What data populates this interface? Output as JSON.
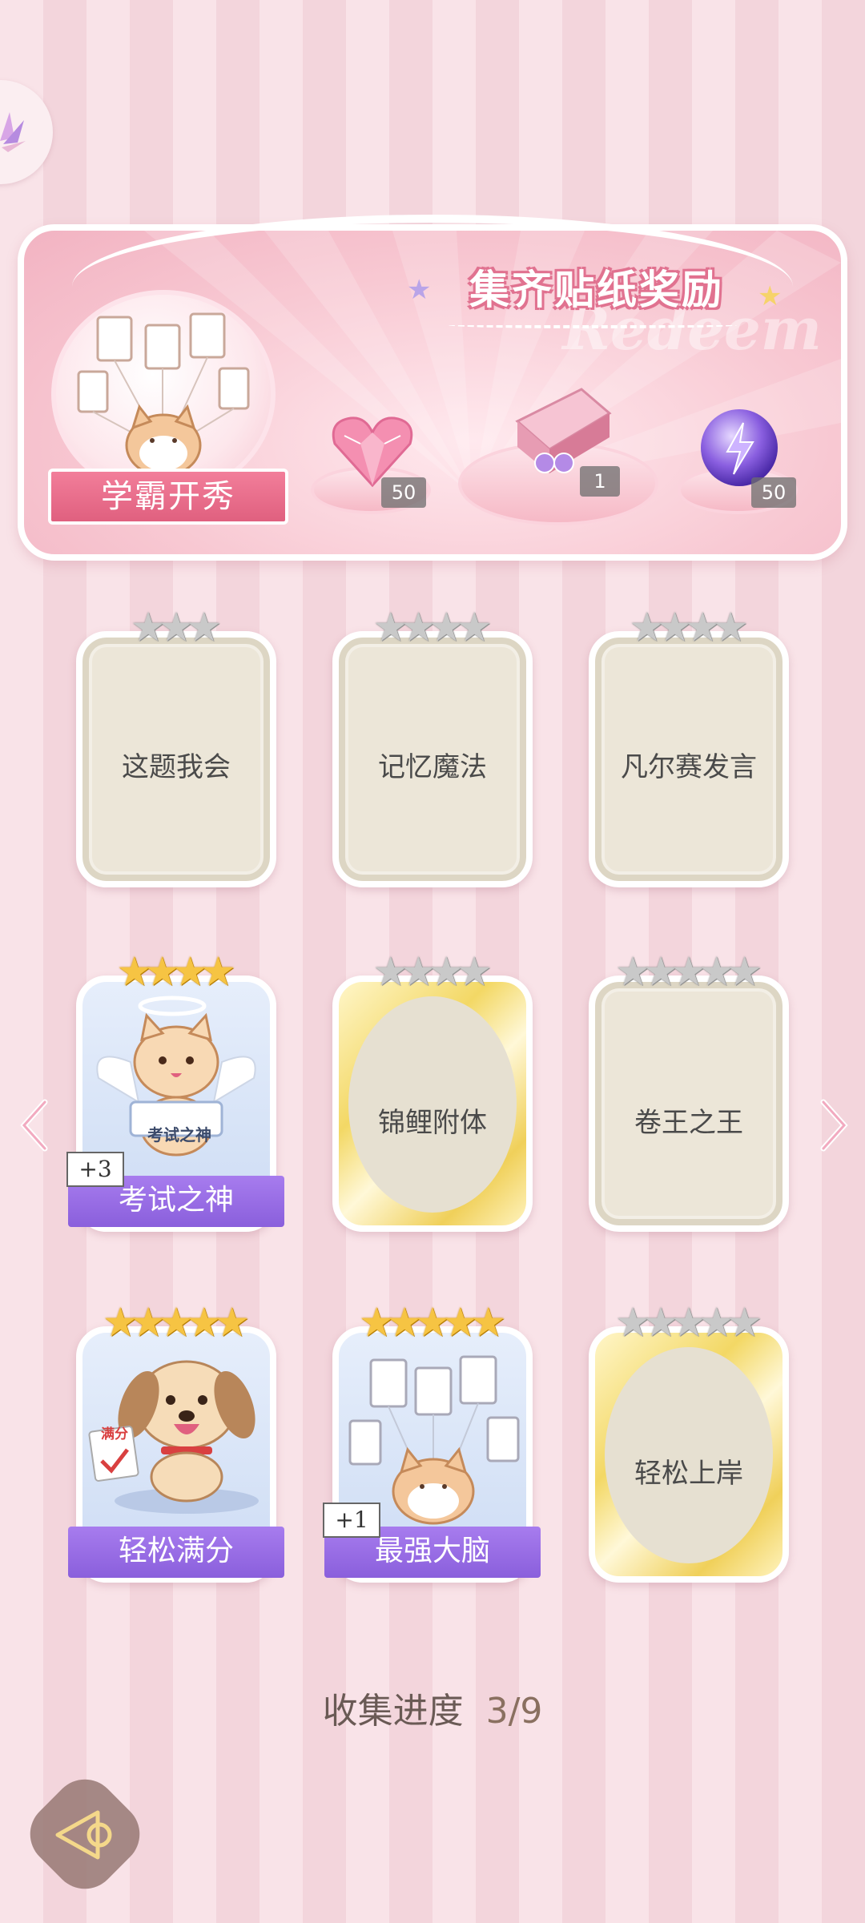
{
  "banner": {
    "title": "集齐贴纸奖励",
    "watermark": "Redeem",
    "set_label": "学霸开秀",
    "rewards": [
      {
        "icon": "pink-heart-gem-icon",
        "count": "50"
      },
      {
        "icon": "gift-box-icon",
        "count": "1"
      },
      {
        "icon": "purple-lightning-orb-icon",
        "count": "50"
      }
    ]
  },
  "cards": [
    {
      "name": "这题我会",
      "state": "blank",
      "stars": 3,
      "star_color": "silver"
    },
    {
      "name": "记忆魔法",
      "state": "blank",
      "stars": 4,
      "star_color": "silver"
    },
    {
      "name": "凡尔赛发言",
      "state": "blank",
      "stars": 4,
      "star_color": "silver"
    },
    {
      "name": "考试之神",
      "state": "collected",
      "stars": 4,
      "star_color": "gold",
      "bonus": "+3",
      "art_text": "考试之神"
    },
    {
      "name": "锦鲤附体",
      "state": "gold-blank",
      "stars": 4,
      "star_color": "silver"
    },
    {
      "name": "卷王之王",
      "state": "blank",
      "stars": 5,
      "star_color": "silver"
    },
    {
      "name": "轻松满分",
      "state": "collected",
      "stars": 5,
      "star_color": "gold",
      "art_text": "满分"
    },
    {
      "name": "最强大脑",
      "state": "collected",
      "stars": 5,
      "star_color": "gold",
      "bonus": "+1"
    },
    {
      "name": "轻松上岸",
      "state": "gold-blank",
      "stars": 5,
      "star_color": "silver"
    }
  ],
  "progress": {
    "label": "收集进度",
    "value": "3/9"
  },
  "colors": {
    "accent_pink": "#e0607f",
    "ribbon_purple": "#9a6de6",
    "gold_star": "#f6c443"
  }
}
